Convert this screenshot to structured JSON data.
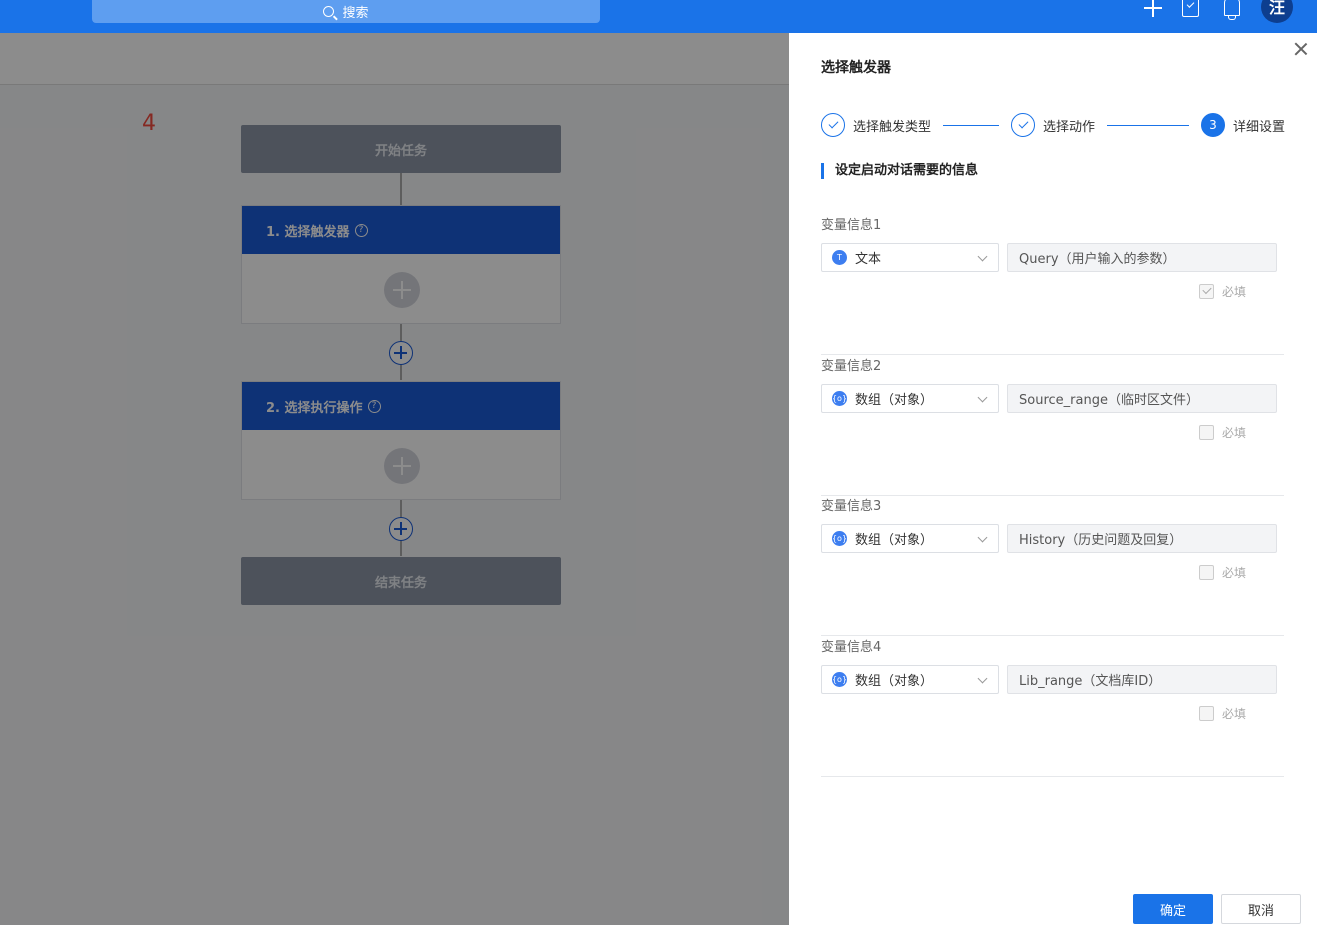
{
  "topbar": {
    "search_label": "搜索",
    "avatar_text": "汪",
    "color": "#1a73e8"
  },
  "canvas": {
    "step_count": "4",
    "start_label": "开始任务",
    "end_label": "结束任务",
    "cards": [
      {
        "title": "1. 选择触发器"
      },
      {
        "title": "2. 选择执行操作"
      }
    ]
  },
  "drawer": {
    "title": "选择触发器",
    "steps": [
      {
        "label": "选择触发类型",
        "status": "done"
      },
      {
        "label": "选择动作",
        "status": "done"
      },
      {
        "label": "详细设置",
        "status": "active",
        "number": "3"
      }
    ],
    "section_title": "设定启动对话需要的信息",
    "variables": [
      {
        "label": "变量信息1",
        "type": "文本",
        "type_icon": "T",
        "value": "Query（用户输入的参数）",
        "required_label": "必填",
        "required": true
      },
      {
        "label": "变量信息2",
        "type": "数组（对象）",
        "type_icon": "{o}",
        "value": "Source_range（临时区文件）",
        "required_label": "必填",
        "required": false
      },
      {
        "label": "变量信息3",
        "type": "数组（对象）",
        "type_icon": "{o}",
        "value": "History（历史问题及回复）",
        "required_label": "必填",
        "required": false
      },
      {
        "label": "变量信息4",
        "type": "数组（对象）",
        "type_icon": "{o}",
        "value": "Lib_range（文档库ID）",
        "required_label": "必填",
        "required": false
      }
    ],
    "confirm_label": "确定",
    "cancel_label": "取消"
  }
}
